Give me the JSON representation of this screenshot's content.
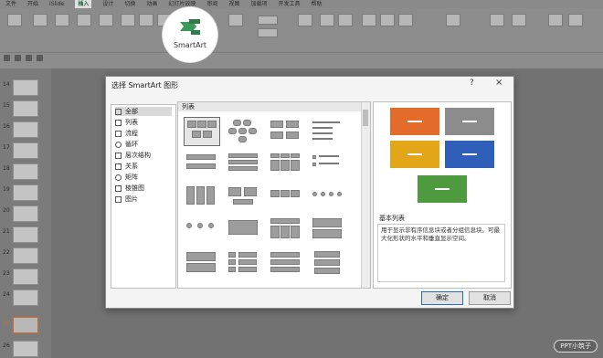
{
  "ribbon": {
    "tabs": [
      "文件",
      "开始",
      "iSlide",
      "插入",
      "设计",
      "切换",
      "动画",
      "幻灯片放映",
      "审阅",
      "视图",
      "加载项",
      "开发工具",
      "帮助"
    ],
    "active_tab": "插入",
    "smartart_label": "SmartArt"
  },
  "thumbnails": {
    "numbers": [
      "14",
      "15",
      "16",
      "17",
      "18",
      "19",
      "20",
      "21",
      "22",
      "23",
      "24",
      "25",
      "26"
    ],
    "selected": "25"
  },
  "watermark": "PPT小筑子",
  "dialog": {
    "title": "选择 SmartArt 图形",
    "help": "?",
    "close": "×",
    "categories": [
      "全部",
      "列表",
      "流程",
      "循环",
      "层次结构",
      "关系",
      "矩阵",
      "棱锥图",
      "图片"
    ],
    "selected_category": "全部",
    "layout_header": "列表",
    "preview_title": "基本列表",
    "preview_description": "用于显示非有序信息块或者分组信息块。可最大化形状的水平和垂直显示空间。",
    "ok_label": "确定",
    "cancel_label": "取消"
  },
  "preview_colors": [
    "#e46c2a",
    "#8c8c8c",
    "#e3a619",
    "#2f5fb8",
    "#4e9a3f"
  ]
}
